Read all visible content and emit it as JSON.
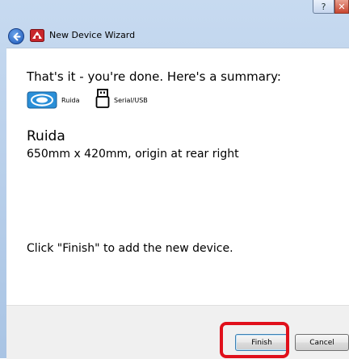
{
  "window": {
    "title": "New Device Wizard",
    "help_label": "?",
    "close_label": "✕"
  },
  "content": {
    "summary_heading": "That's it - you're done.  Here's a summary:",
    "device_icon_label": "Ruida",
    "connection_label": "Serial/USB",
    "device_name": "Ruida",
    "device_description": "650mm x 420mm, origin at rear right",
    "finish_hint": "Click \"Finish\" to add the new device."
  },
  "buttons": {
    "finish": "Finish",
    "cancel": "Cancel"
  },
  "colors": {
    "highlight": "#e0101b",
    "accent": "#1c56b6"
  }
}
